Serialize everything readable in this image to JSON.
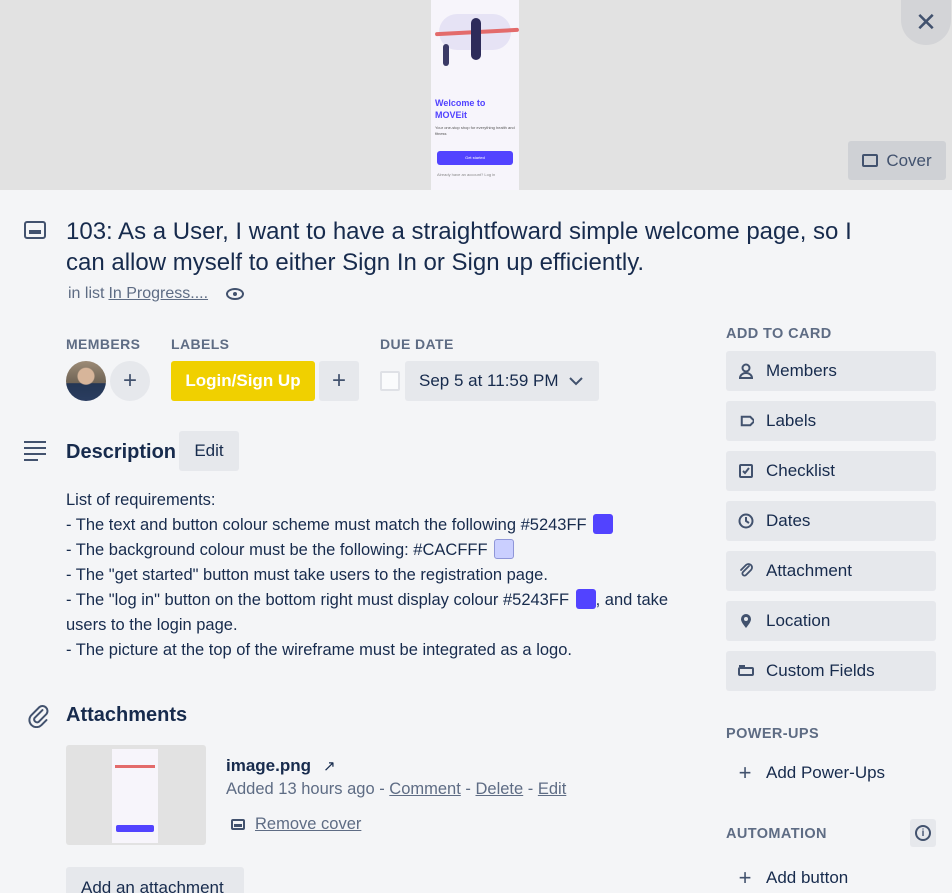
{
  "cover": {
    "button_label": "Cover",
    "thumb_title": "Welcome to MOVEit",
    "thumb_subtitle": "Your one-stop shop for everything health and fitness",
    "thumb_button": "Get started",
    "thumb_footer": "Already have an account? Log in"
  },
  "card": {
    "title": "103: As a User, I want to have a straightfoward simple welcome page, so I can allow myself to either Sign In or Sign up efficiently.",
    "in_list_prefix": "in list",
    "list_name": "In Progress...."
  },
  "members": {
    "label": "MEMBERS",
    "add": "+"
  },
  "labels": {
    "label": "LABELS",
    "chip": "Login/Sign Up",
    "chip_color": "#F0D000",
    "add": "+"
  },
  "due": {
    "label": "DUE DATE",
    "value": "Sep 5 at 11:59 PM"
  },
  "description": {
    "heading": "Description",
    "edit": "Edit",
    "lines": {
      "l1": "List of requirements:",
      "l2": "- The text and button colour scheme must match the following #5243FF",
      "l3": "- The background colour must be the following: #CACFFF",
      "l4": "- The \"get started\" button must take users to the registration page.",
      "l5a": "- The \"log in\" button on the bottom right must display colour #5243FF",
      "l5b": ", and take users to the login page.",
      "l6": "- The picture at the top of the wireframe must be integrated as a logo."
    },
    "colors": {
      "primary": "#5243FF",
      "background": "#CACFFF"
    }
  },
  "attachments": {
    "heading": "Attachments",
    "file_name": "image.png",
    "arrow": "↗",
    "added": "Added 13 hours ago - ",
    "comment": "Comment",
    "sep": " - ",
    "delete": "Delete",
    "edit": "Edit",
    "remove_cover": "Remove cover",
    "add_attachment": "Add an attachment"
  },
  "sidebar": {
    "add_to_card": "ADD TO CARD",
    "items": [
      {
        "label": "Members",
        "icon": "person-icon"
      },
      {
        "label": "Labels",
        "icon": "tag-icon"
      },
      {
        "label": "Checklist",
        "icon": "checkbox-icon"
      },
      {
        "label": "Dates",
        "icon": "clock-icon"
      },
      {
        "label": "Attachment",
        "icon": "paperclip-icon"
      },
      {
        "label": "Location",
        "icon": "pin-icon"
      },
      {
        "label": "Custom Fields",
        "icon": "fields-icon"
      }
    ],
    "power_ups": "POWER-UPS",
    "add_power_ups": "Add Power-Ups",
    "automation": "AUTOMATION",
    "add_button": "Add button"
  }
}
